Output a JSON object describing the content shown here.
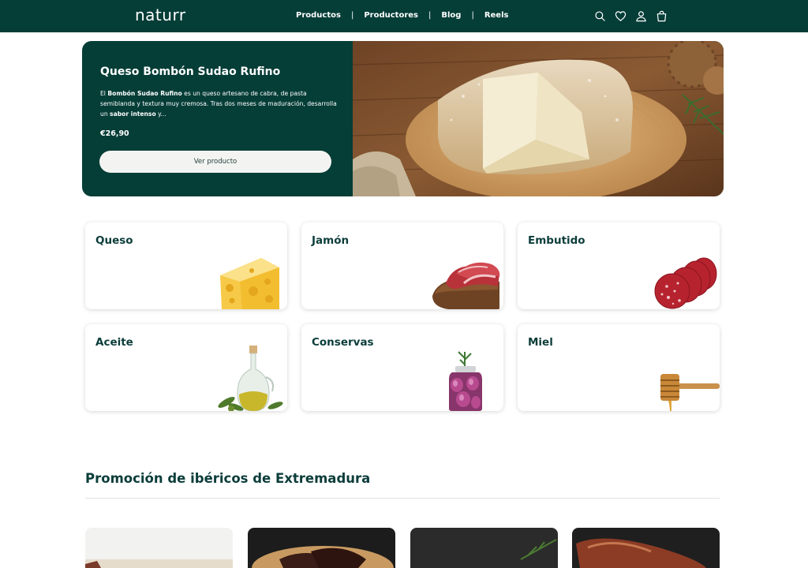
{
  "brand": {
    "logo": "naturr",
    "primary_color": "#053d37"
  },
  "nav": {
    "items": [
      "Productos",
      "Productores",
      "Blog",
      "Reels"
    ],
    "separator": "|"
  },
  "header_icons": [
    "search-icon",
    "heart-icon",
    "user-icon",
    "cart-icon"
  ],
  "hero": {
    "title": "Queso Bombón Sudao Rufino",
    "desc_pre": "El ",
    "desc_bold1": "Bombón Sudao Rufino",
    "desc_mid": " es un queso artesano de cabra, de pasta semiblanda y textura muy cremosa. Tras dos meses de maduración, desarrolla un ",
    "desc_bold2": "sabor intenso",
    "desc_post": " y...",
    "price": "€26,90",
    "button": "Ver producto"
  },
  "categories": [
    {
      "label": "Queso",
      "icon": "cheese-icon"
    },
    {
      "label": "Jamón",
      "icon": "ham-icon"
    },
    {
      "label": "Embutido",
      "icon": "sausage-icon"
    },
    {
      "label": "Aceite",
      "icon": "oil-bottle-icon"
    },
    {
      "label": "Conservas",
      "icon": "jar-icon"
    },
    {
      "label": "Miel",
      "icon": "honey-dipper-icon"
    }
  ],
  "promo": {
    "title": "Promoción de ibéricos de Extremadura"
  }
}
